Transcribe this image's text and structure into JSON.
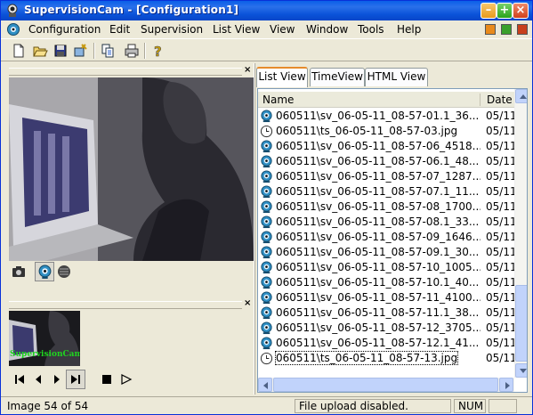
{
  "window": {
    "title": "SupervisionCam - [Configuration1]"
  },
  "menu": {
    "items": [
      "Configuration",
      "Edit",
      "Supervision",
      "List View",
      "View",
      "Window",
      "Tools",
      "Help"
    ]
  },
  "toolbar": {
    "icons": [
      "new-icon",
      "open-icon",
      "save-icon",
      "wizard-icon",
      "copy-icon",
      "print-icon",
      "help-icon"
    ]
  },
  "thumbnail": {
    "logo_text": "SupervisionCam"
  },
  "tabs": [
    {
      "label": "List View",
      "active": true
    },
    {
      "label": "TimeView",
      "active": false
    },
    {
      "label": "HTML View",
      "active": false
    }
  ],
  "list": {
    "columns": [
      "Name",
      "Date"
    ],
    "rows": [
      {
        "name": "060511\\sv_06-05-11_08-57-01.1_36...",
        "date": "05/11",
        "icon": "camera-icon"
      },
      {
        "name": "060511\\ts_06-05-11_08-57-03.jpg",
        "date": "05/11",
        "icon": "clock-icon"
      },
      {
        "name": "060511\\sv_06-05-11_08-57-06_4518...",
        "date": "05/11",
        "icon": "camera-icon"
      },
      {
        "name": "060511\\sv_06-05-11_08-57-06.1_48...",
        "date": "05/11",
        "icon": "camera-icon"
      },
      {
        "name": "060511\\sv_06-05-11_08-57-07_1287...",
        "date": "05/11",
        "icon": "camera-icon"
      },
      {
        "name": "060511\\sv_06-05-11_08-57-07.1_11...",
        "date": "05/11",
        "icon": "camera-icon"
      },
      {
        "name": "060511\\sv_06-05-11_08-57-08_1700...",
        "date": "05/11",
        "icon": "camera-icon"
      },
      {
        "name": "060511\\sv_06-05-11_08-57-08.1_33...",
        "date": "05/11",
        "icon": "camera-icon"
      },
      {
        "name": "060511\\sv_06-05-11_08-57-09_1646...",
        "date": "05/11",
        "icon": "camera-icon"
      },
      {
        "name": "060511\\sv_06-05-11_08-57-09.1_30...",
        "date": "05/11",
        "icon": "camera-icon"
      },
      {
        "name": "060511\\sv_06-05-11_08-57-10_1005...",
        "date": "05/11",
        "icon": "camera-icon"
      },
      {
        "name": "060511\\sv_06-05-11_08-57-10.1_40...",
        "date": "05/11",
        "icon": "camera-icon"
      },
      {
        "name": "060511\\sv_06-05-11_08-57-11_4100...",
        "date": "05/11",
        "icon": "camera-icon"
      },
      {
        "name": "060511\\sv_06-05-11_08-57-11.1_38...",
        "date": "05/11",
        "icon": "camera-icon"
      },
      {
        "name": "060511\\sv_06-05-11_08-57-12_3705...",
        "date": "05/11",
        "icon": "camera-icon"
      },
      {
        "name": "060511\\sv_06-05-11_08-57-12.1_41...",
        "date": "05/11",
        "icon": "camera-icon"
      },
      {
        "name": "060511\\ts_06-05-11_08-57-13.jpg",
        "date": "05/11",
        "icon": "clock-icon",
        "selected": true
      }
    ]
  },
  "status": {
    "image_counter": "Image 54 of 54",
    "upload": "File upload disabled.",
    "num": "NUM"
  }
}
